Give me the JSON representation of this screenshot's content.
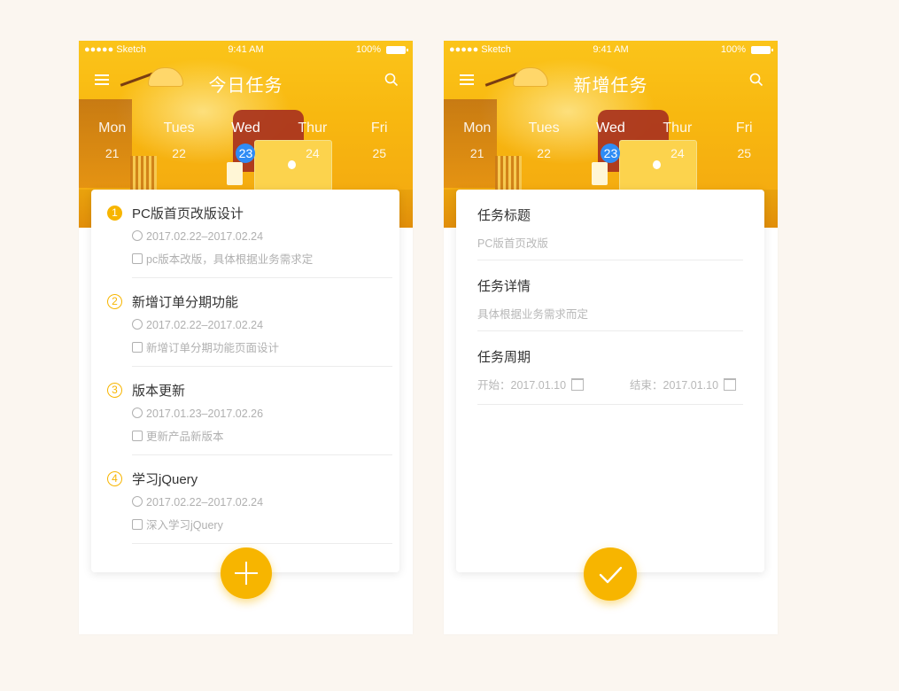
{
  "colors": {
    "accent": "#f7b500",
    "selected_day": "#2f8cf5",
    "page_bg": "#fbf6f0",
    "muted_text": "#b0b0b0"
  },
  "left_screen": {
    "status": {
      "carrier": "●●●●● Sketch",
      "time": "9:41 AM",
      "battery": "100%"
    },
    "nav": {
      "title": "今日任务",
      "menu_icon": "menu-icon",
      "search_icon": "search-icon"
    },
    "days": [
      {
        "name": "Mon",
        "num": "21"
      },
      {
        "name": "Tues",
        "num": "22"
      },
      {
        "name": "Wed",
        "num": "23"
      },
      {
        "name": "Thur",
        "num": "24"
      },
      {
        "name": "Fri",
        "num": "25"
      }
    ],
    "tasks": [
      {
        "num": "1",
        "title": "PC版首页改版设计",
        "period": "2017.02.22–2017.02.24",
        "note": "pc版本改版，具体根据业务需求定"
      },
      {
        "num": "2",
        "title": "新增订单分期功能",
        "period": "2017.02.22–2017.02.24",
        "note": "新增订单分期功能页面设计"
      },
      {
        "num": "3",
        "title": "版本更新",
        "period": "2017.01.23–2017.02.26",
        "note": "更新产品新版本"
      },
      {
        "num": "4",
        "title": "学习jQuery",
        "period": "2017.02.22–2017.02.24",
        "note": "深入学习jQuery"
      }
    ],
    "fab_icon": "plus-icon"
  },
  "right_screen": {
    "status": {
      "carrier": "●●●●● Sketch",
      "time": "9:41 AM",
      "battery": "100%"
    },
    "nav": {
      "title": "新增任务",
      "menu_icon": "menu-icon",
      "search_icon": "search-icon"
    },
    "days": [
      {
        "name": "Mon",
        "num": "21"
      },
      {
        "name": "Tues",
        "num": "22"
      },
      {
        "name": "Wed",
        "num": "23"
      },
      {
        "name": "Thur",
        "num": "24"
      },
      {
        "name": "Fri",
        "num": "25"
      }
    ],
    "form": {
      "title_label": "任务标题",
      "title_value": "PC版首页改版",
      "detail_label": "任务详情",
      "detail_value": "具体根据业务需求而定",
      "period_label": "任务周期",
      "start": "开始：2017.01.10",
      "end": "结束：2017.01.10"
    },
    "fab_icon": "check-icon"
  }
}
